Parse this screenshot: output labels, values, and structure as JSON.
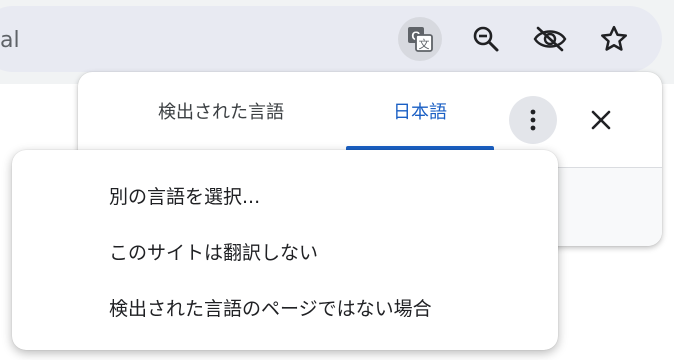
{
  "toolbar": {
    "url_fragment": "al",
    "icons": [
      "translate-icon",
      "zoom-out-icon",
      "eye-off-icon",
      "star-icon"
    ]
  },
  "translate_bubble": {
    "tabs": [
      {
        "label": "検出された言語",
        "selected": false
      },
      {
        "label": "日本語",
        "selected": true
      }
    ],
    "accent_color": "#1a5fc4"
  },
  "options_menu": {
    "items": [
      {
        "label": "別の言語を選択..."
      },
      {
        "label": "このサイトは翻訳しない"
      },
      {
        "label": "検出された言語のページではない場合"
      }
    ]
  }
}
